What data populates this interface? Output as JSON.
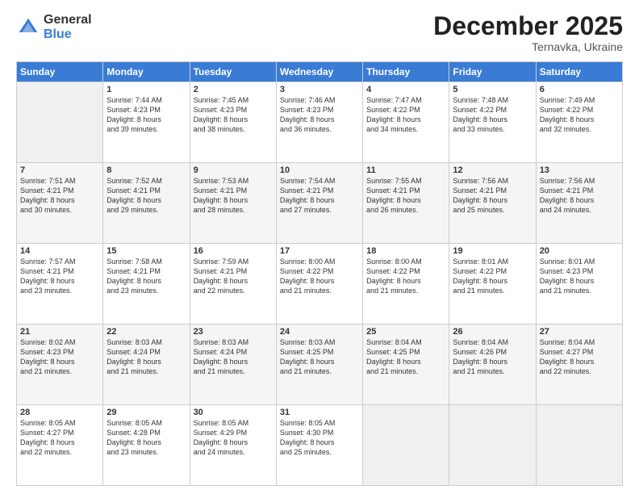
{
  "header": {
    "logo_general": "General",
    "logo_blue": "Blue",
    "month_title": "December 2025",
    "location": "Ternavka, Ukraine"
  },
  "weekdays": [
    "Sunday",
    "Monday",
    "Tuesday",
    "Wednesday",
    "Thursday",
    "Friday",
    "Saturday"
  ],
  "rows": [
    [
      {
        "day": "",
        "info": ""
      },
      {
        "day": "1",
        "info": "Sunrise: 7:44 AM\nSunset: 4:23 PM\nDaylight: 8 hours\nand 39 minutes."
      },
      {
        "day": "2",
        "info": "Sunrise: 7:45 AM\nSunset: 4:23 PM\nDaylight: 8 hours\nand 38 minutes."
      },
      {
        "day": "3",
        "info": "Sunrise: 7:46 AM\nSunset: 4:23 PM\nDaylight: 8 hours\nand 36 minutes."
      },
      {
        "day": "4",
        "info": "Sunrise: 7:47 AM\nSunset: 4:22 PM\nDaylight: 8 hours\nand 34 minutes."
      },
      {
        "day": "5",
        "info": "Sunrise: 7:48 AM\nSunset: 4:22 PM\nDaylight: 8 hours\nand 33 minutes."
      },
      {
        "day": "6",
        "info": "Sunrise: 7:49 AM\nSunset: 4:22 PM\nDaylight: 8 hours\nand 32 minutes."
      }
    ],
    [
      {
        "day": "7",
        "info": "Sunrise: 7:51 AM\nSunset: 4:21 PM\nDaylight: 8 hours\nand 30 minutes."
      },
      {
        "day": "8",
        "info": "Sunrise: 7:52 AM\nSunset: 4:21 PM\nDaylight: 8 hours\nand 29 minutes."
      },
      {
        "day": "9",
        "info": "Sunrise: 7:53 AM\nSunset: 4:21 PM\nDaylight: 8 hours\nand 28 minutes."
      },
      {
        "day": "10",
        "info": "Sunrise: 7:54 AM\nSunset: 4:21 PM\nDaylight: 8 hours\nand 27 minutes."
      },
      {
        "day": "11",
        "info": "Sunrise: 7:55 AM\nSunset: 4:21 PM\nDaylight: 8 hours\nand 26 minutes."
      },
      {
        "day": "12",
        "info": "Sunrise: 7:56 AM\nSunset: 4:21 PM\nDaylight: 8 hours\nand 25 minutes."
      },
      {
        "day": "13",
        "info": "Sunrise: 7:56 AM\nSunset: 4:21 PM\nDaylight: 8 hours\nand 24 minutes."
      }
    ],
    [
      {
        "day": "14",
        "info": "Sunrise: 7:57 AM\nSunset: 4:21 PM\nDaylight: 8 hours\nand 23 minutes."
      },
      {
        "day": "15",
        "info": "Sunrise: 7:58 AM\nSunset: 4:21 PM\nDaylight: 8 hours\nand 23 minutes."
      },
      {
        "day": "16",
        "info": "Sunrise: 7:59 AM\nSunset: 4:21 PM\nDaylight: 8 hours\nand 22 minutes."
      },
      {
        "day": "17",
        "info": "Sunrise: 8:00 AM\nSunset: 4:22 PM\nDaylight: 8 hours\nand 21 minutes."
      },
      {
        "day": "18",
        "info": "Sunrise: 8:00 AM\nSunset: 4:22 PM\nDaylight: 8 hours\nand 21 minutes."
      },
      {
        "day": "19",
        "info": "Sunrise: 8:01 AM\nSunset: 4:22 PM\nDaylight: 8 hours\nand 21 minutes."
      },
      {
        "day": "20",
        "info": "Sunrise: 8:01 AM\nSunset: 4:23 PM\nDaylight: 8 hours\nand 21 minutes."
      }
    ],
    [
      {
        "day": "21",
        "info": "Sunrise: 8:02 AM\nSunset: 4:23 PM\nDaylight: 8 hours\nand 21 minutes."
      },
      {
        "day": "22",
        "info": "Sunrise: 8:03 AM\nSunset: 4:24 PM\nDaylight: 8 hours\nand 21 minutes."
      },
      {
        "day": "23",
        "info": "Sunrise: 8:03 AM\nSunset: 4:24 PM\nDaylight: 8 hours\nand 21 minutes."
      },
      {
        "day": "24",
        "info": "Sunrise: 8:03 AM\nSunset: 4:25 PM\nDaylight: 8 hours\nand 21 minutes."
      },
      {
        "day": "25",
        "info": "Sunrise: 8:04 AM\nSunset: 4:25 PM\nDaylight: 8 hours\nand 21 minutes."
      },
      {
        "day": "26",
        "info": "Sunrise: 8:04 AM\nSunset: 4:26 PM\nDaylight: 8 hours\nand 21 minutes."
      },
      {
        "day": "27",
        "info": "Sunrise: 8:04 AM\nSunset: 4:27 PM\nDaylight: 8 hours\nand 22 minutes."
      }
    ],
    [
      {
        "day": "28",
        "info": "Sunrise: 8:05 AM\nSunset: 4:27 PM\nDaylight: 8 hours\nand 22 minutes."
      },
      {
        "day": "29",
        "info": "Sunrise: 8:05 AM\nSunset: 4:28 PM\nDaylight: 8 hours\nand 23 minutes."
      },
      {
        "day": "30",
        "info": "Sunrise: 8:05 AM\nSunset: 4:29 PM\nDaylight: 8 hours\nand 24 minutes."
      },
      {
        "day": "31",
        "info": "Sunrise: 8:05 AM\nSunset: 4:30 PM\nDaylight: 8 hours\nand 25 minutes."
      },
      {
        "day": "",
        "info": ""
      },
      {
        "day": "",
        "info": ""
      },
      {
        "day": "",
        "info": ""
      }
    ]
  ]
}
